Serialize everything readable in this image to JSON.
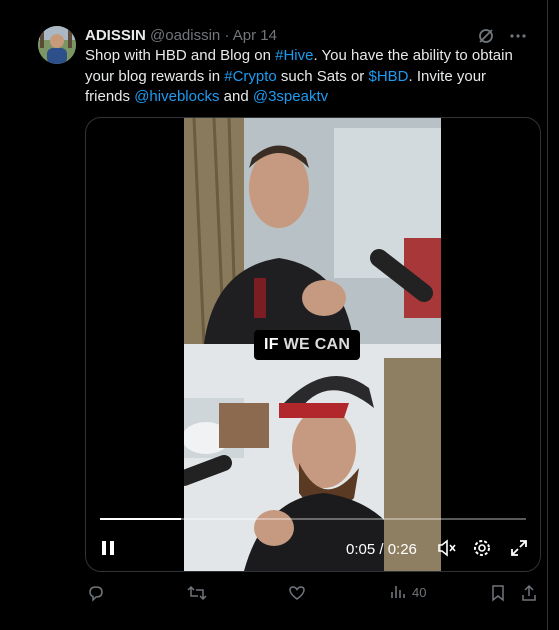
{
  "tweet": {
    "author_name": "ADISSIN",
    "handle": "@oadissin",
    "separator": "·",
    "date": "Apr 14",
    "text": {
      "t1": "Shop with HBD and Blog on ",
      "hive": "#Hive",
      "t2": ". You have the ability to obtain your blog rewards in ",
      "crypto": "#Crypto",
      "t3": " such Sats or ",
      "hbd": "$HBD",
      "t4": ". Invite your friends ",
      "hiveblocks": "@hiveblocks",
      "t5": " and ",
      "threespeak": "@3speaktv"
    }
  },
  "video": {
    "caption_a": "IF",
    "caption_b": "WE CAN",
    "time": "0:05 / 0:26",
    "progress": 0.19
  },
  "actions": {
    "views": "40"
  },
  "colors": {
    "link": "#1d9bf0",
    "muted": "#71767b",
    "text": "#e7e9ea"
  },
  "icons": [
    "grok-icon",
    "more-icon",
    "pause-icon",
    "mute-icon",
    "settings-icon",
    "fullscreen-icon",
    "reply-icon",
    "retweet-icon",
    "like-icon",
    "views-icon",
    "bookmark-icon",
    "share-icon"
  ]
}
